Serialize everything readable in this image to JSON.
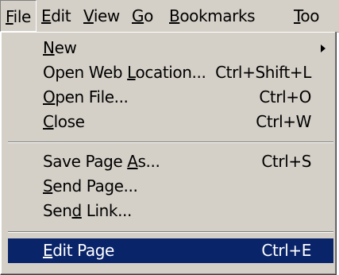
{
  "colors": {
    "menu_bg": "#d4d0c8",
    "highlight_bg": "#0a246a",
    "highlight_text": "#ffffff"
  },
  "menubar": {
    "items": [
      {
        "mnemonic": "F",
        "rest": "ile"
      },
      {
        "mnemonic": "E",
        "rest": "dit"
      },
      {
        "mnemonic": "V",
        "rest": "iew"
      },
      {
        "mnemonic": "G",
        "rest": "o"
      },
      {
        "mnemonic": "B",
        "rest": "ookmarks"
      },
      {
        "mnemonic": "T",
        "rest": "oo"
      }
    ]
  },
  "file_menu": {
    "items": [
      {
        "pre": "",
        "mnemonic": "N",
        "post": "ew",
        "shortcut": "",
        "submenu_icon": "triangle-right-icon"
      },
      {
        "pre": "Open Web ",
        "mnemonic": "L",
        "post": "ocation...",
        "shortcut": "Ctrl+Shift+L"
      },
      {
        "pre": "",
        "mnemonic": "O",
        "post": "pen File...",
        "shortcut": "Ctrl+O"
      },
      {
        "pre": "",
        "mnemonic": "C",
        "post": "lose",
        "shortcut": "Ctrl+W"
      },
      {
        "pre": "Save Page ",
        "mnemonic": "A",
        "post": "s...",
        "shortcut": "Ctrl+S"
      },
      {
        "pre": "",
        "mnemonic": "S",
        "post": "end Page...",
        "shortcut": ""
      },
      {
        "pre": "Sen",
        "mnemonic": "d",
        "post": " Link...",
        "shortcut": ""
      },
      {
        "pre": "",
        "mnemonic": "E",
        "post": "dit Page",
        "shortcut": "Ctrl+E",
        "highlighted": true
      }
    ]
  }
}
